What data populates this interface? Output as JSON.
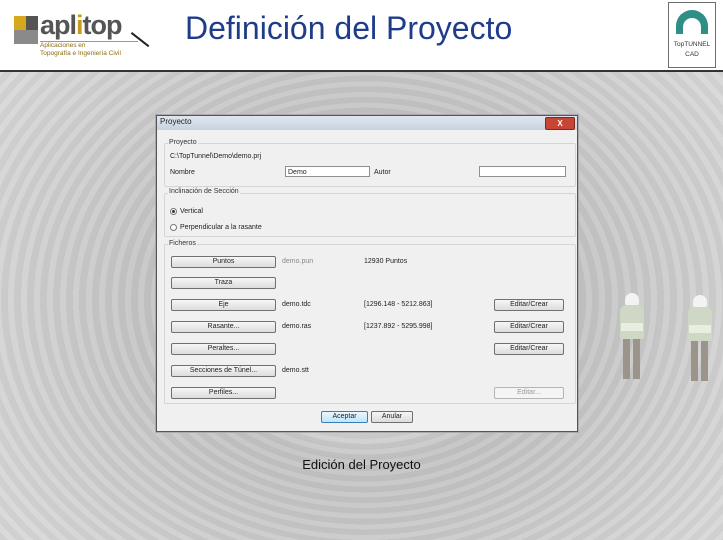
{
  "slide": {
    "title": "Definición del Proyecto",
    "caption": "Edición del Proyecto"
  },
  "logo": {
    "name_a": "apl",
    "name_i": "i",
    "name_b": "top",
    "subtitle_1": "Aplicaciones en",
    "subtitle_2": "Topografía e Ingeniería Civil"
  },
  "brand": {
    "line1": "TopTUNNEL",
    "line2": "CAD"
  },
  "dialog": {
    "title": "Proyecto",
    "close_label": "X",
    "project_group": {
      "label": "Proyecto",
      "path": "C:\\TopTunnel\\Demo\\demo.prj",
      "name_label": "Nombre",
      "name_value": "Demo",
      "author_label": "Autor",
      "author_value": ""
    },
    "section_group": {
      "label": "Inclinación de Sección",
      "options": [
        "Vertical",
        "Perpendicular a la rasante"
      ],
      "selected": "Vertical"
    },
    "files_group": {
      "label": "Ficheros",
      "rows": [
        {
          "button": "Puntos",
          "file": "demo.pun",
          "info": "12930 Puntos",
          "action": ""
        },
        {
          "button": "Traza",
          "file": "",
          "info": "",
          "action": ""
        },
        {
          "button": "Eje",
          "file": "demo.tdc",
          "info": "[1296.148 - 5212.863]",
          "action": "Editar/Crear"
        },
        {
          "button": "Rasante...",
          "file": "demo.ras",
          "info": "[1237.892 - 5295.998]",
          "action": "Editar/Crear"
        },
        {
          "button": "Peraltes...",
          "file": "",
          "info": "",
          "action": "Editar/Crear"
        },
        {
          "button": "Secciones de Túnel...",
          "file": "demo.stt",
          "info": "",
          "action": ""
        },
        {
          "button": "Perfiles...",
          "file": "",
          "info": "",
          "action": "Editar..."
        }
      ]
    },
    "accept_label": "Aceptar",
    "cancel_label": "Anular"
  }
}
